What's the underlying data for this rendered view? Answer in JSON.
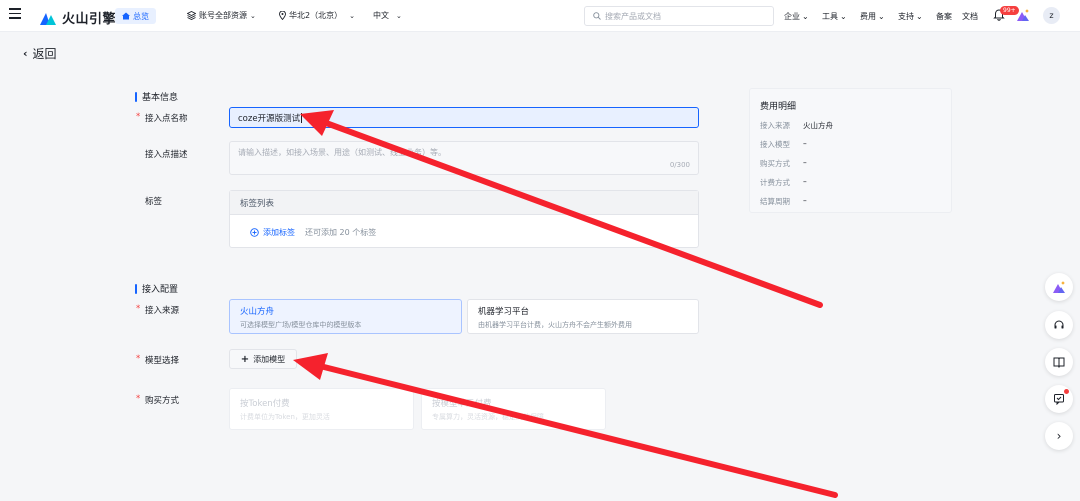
{
  "header": {
    "brand": "火山引擎",
    "overview": "总览",
    "account_scope": "账号全部资源",
    "region": "华北2（北京）",
    "language": "中文",
    "search_placeholder": "搜索产品或文档",
    "nav": [
      "企业",
      "工具",
      "费用",
      "支持",
      "备案",
      "文档"
    ],
    "notifications_badge": "99+",
    "avatar_letter": "z"
  },
  "back_label": "返回",
  "basic": {
    "section_title": "基本信息",
    "name_label": "接入点名称",
    "name_value": "coze开源版测试",
    "desc_label": "接入点描述",
    "desc_placeholder": "请输入描述，如接入场景、用途（如测试、线上业务）等。",
    "desc_count": "0/300",
    "tags_label": "标签",
    "tags_list_title": "标签列表",
    "add_tag": "添加标签",
    "tag_hint": "还可添加 20 个标签"
  },
  "config": {
    "section_title": "接入配置",
    "source_label": "接入来源",
    "sources": [
      {
        "title": "火山方舟",
        "desc": "可选择模型广场/模型仓库中的模型版本"
      },
      {
        "title": "机器学习平台",
        "desc": "由机器学习平台计费，火山方舟不会产生额外费用"
      }
    ],
    "model_label": "模型选择",
    "add_model": "添加模型",
    "purchase_label": "购买方式",
    "purchases": [
      {
        "title": "按Token付费",
        "desc": "计费单位为Token，更加灵活"
      },
      {
        "title": "按模型单元付费",
        "desc": "专属算力，灵活资源，稳定高效保障"
      }
    ]
  },
  "fees": {
    "title": "费用明细",
    "rows": [
      {
        "k": "接入来源",
        "v": "火山方舟"
      },
      {
        "k": "接入模型",
        "v": "–"
      },
      {
        "k": "购买方式",
        "v": "–"
      },
      {
        "k": "计费方式",
        "v": "–"
      },
      {
        "k": "结算周期",
        "v": "–"
      }
    ]
  },
  "colors": {
    "accent": "#1664ff",
    "required": "#f53f3f",
    "arrow": "#f5222d"
  }
}
